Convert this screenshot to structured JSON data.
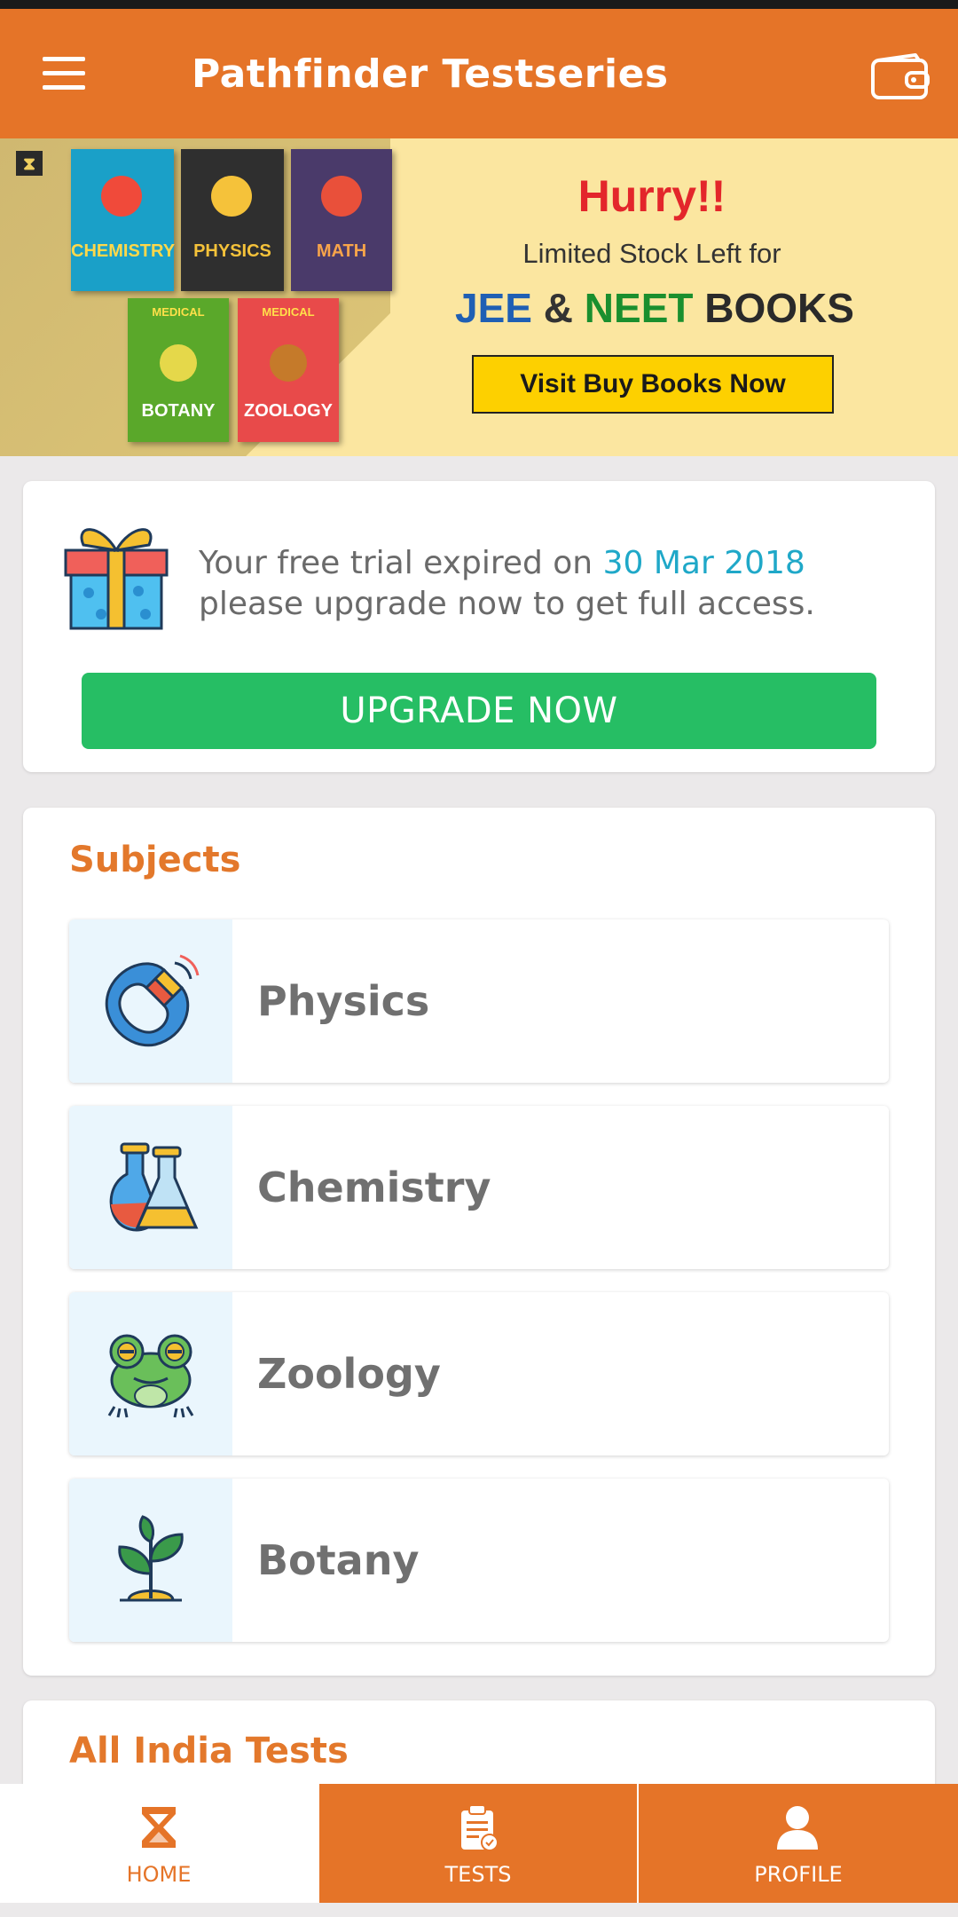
{
  "app": {
    "title": "Pathfinder Testseries",
    "accent_color": "#e57428"
  },
  "banner": {
    "books": [
      {
        "title": "CHEMISTRY",
        "color": "#1aa0c8"
      },
      {
        "title": "PHYSICS",
        "color": "#2f2f2f"
      },
      {
        "title": "MATH",
        "color": "#4a3a6a"
      },
      {
        "title": "BOTANY",
        "tag": "MEDICAL",
        "color": "#5aa82a"
      },
      {
        "title": "ZOOLOGY",
        "tag": "MEDICAL",
        "color": "#e84a4a"
      }
    ],
    "headline": "Hurry!!",
    "subheadline": "Limited Stock Left for",
    "jee": "JEE",
    "amp": "&",
    "neet": "NEET",
    "books_word": "BOOKS",
    "cta": "Visit Buy Books Now"
  },
  "trial": {
    "message_prefix": "Your free trial expired on",
    "date": "30 Mar 2018",
    "message_suffix": "please upgrade now to get full access.",
    "button": "UPGRADE NOW",
    "button_color": "#26be64"
  },
  "subjects": {
    "title": "Subjects",
    "items": [
      {
        "label": "Physics",
        "icon": "magnet-icon"
      },
      {
        "label": "Chemistry",
        "icon": "flask-icon"
      },
      {
        "label": "Zoology",
        "icon": "frog-icon"
      },
      {
        "label": "Botany",
        "icon": "plant-icon"
      }
    ]
  },
  "tests_section": {
    "title": "All India Tests"
  },
  "nav": {
    "home": "HOME",
    "tests": "TESTS",
    "profile": "PROFILE"
  }
}
